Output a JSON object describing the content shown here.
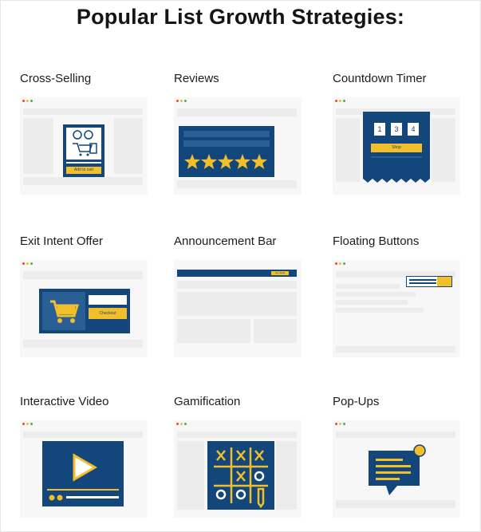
{
  "title": "Popular List Growth Strategies:",
  "colors": {
    "navy": "#13467a",
    "gold": "#f2bf2b",
    "dot_red": "#e8483b",
    "dot_yellow": "#f2bf2b",
    "dot_green": "#3fb55a",
    "placeholder": "#ececec"
  },
  "cards": [
    {
      "label": "Cross-Selling",
      "button": "Add to cart"
    },
    {
      "label": "Reviews",
      "stars": 5
    },
    {
      "label": "Countdown Timer",
      "digits": [
        "1",
        "3",
        "4"
      ],
      "button": "Shop"
    },
    {
      "label": "Exit Intent Offer",
      "icon": "shopping-cart-icon",
      "button": "Checkout"
    },
    {
      "label": "Announcement Bar",
      "button": "Get Deal"
    },
    {
      "label": "Floating Buttons"
    },
    {
      "label": "Interactive Video",
      "icon": "play-icon"
    },
    {
      "label": "Gamification",
      "icon": "tic-tac-toe-icon"
    },
    {
      "label": "Pop-Ups",
      "icon": "chat-bubble-icon"
    }
  ]
}
